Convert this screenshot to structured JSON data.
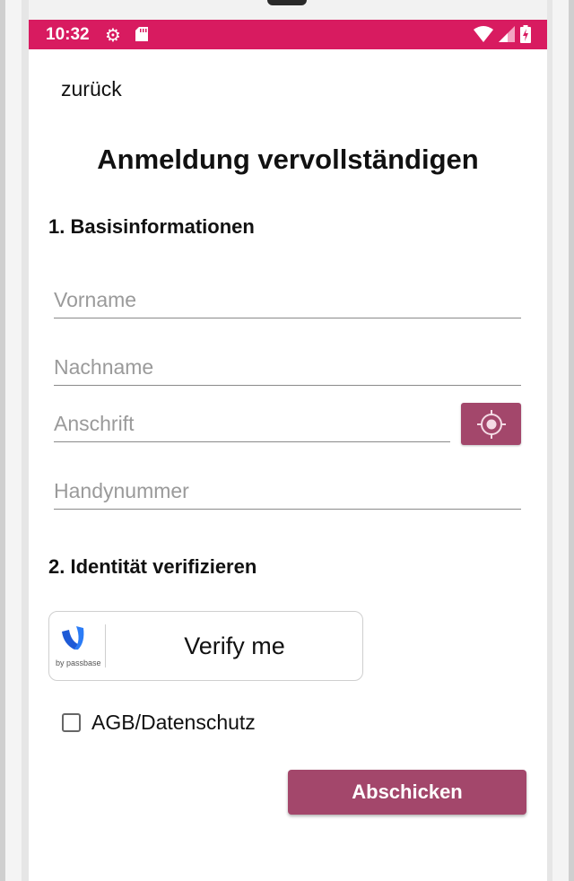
{
  "status_bar": {
    "time": "10:32",
    "color": "#d81b60"
  },
  "nav": {
    "back_label": "zurück"
  },
  "title": "Anmeldung vervollständigen",
  "section1": {
    "title": "1. Basisinformationen",
    "first_name_placeholder": "Vorname",
    "last_name_placeholder": "Nachname",
    "address_placeholder": "Anschrift",
    "phone_placeholder": "Handynummer",
    "locate_icon": "crosshair-location-icon"
  },
  "section2": {
    "title": "2. Identität verifizieren",
    "verify_label": "Verify me",
    "provider_text": "by passbase"
  },
  "terms": {
    "label": "AGB/Datenschutz",
    "checked": false
  },
  "submit_label": "Abschicken",
  "colors": {
    "accent": "#a3476b",
    "status": "#d81b60"
  }
}
